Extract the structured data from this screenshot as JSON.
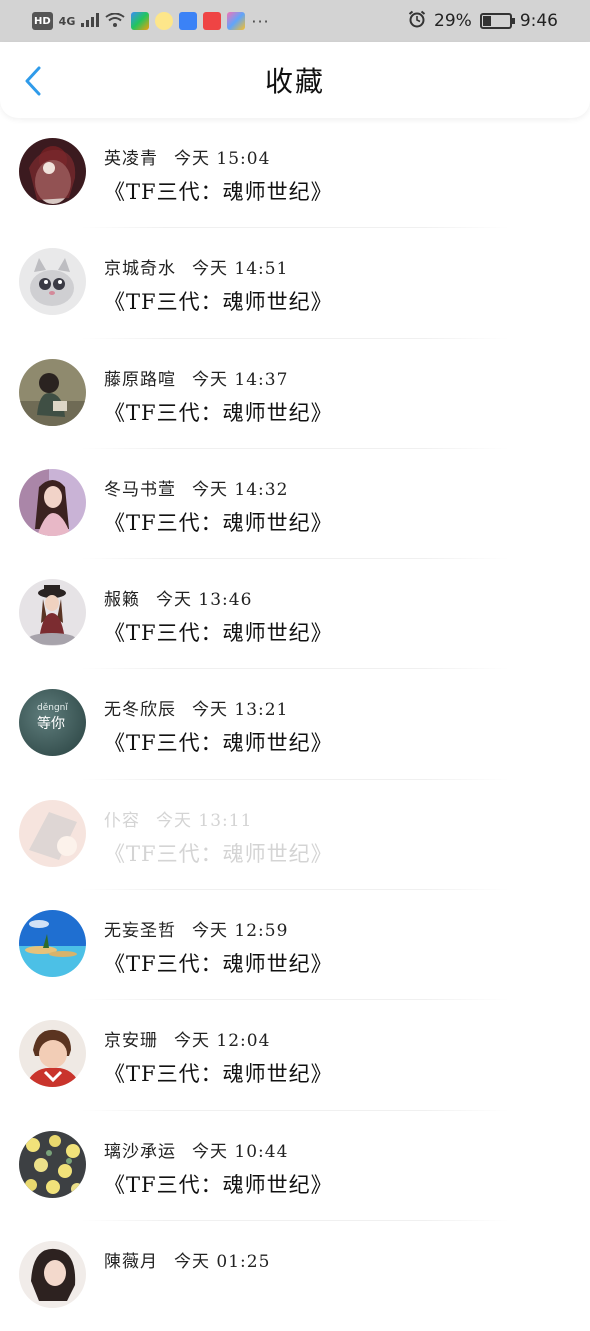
{
  "status_bar": {
    "hd": "HD",
    "network": "4G",
    "battery": "29%",
    "time": "9:46",
    "dots": "···"
  },
  "header": {
    "title": "收藏",
    "back_icon": "chevron-left-icon"
  },
  "items": [
    {
      "name": "英凌青",
      "time": "今天 15:04",
      "book": "《TF三代：魂师世纪》"
    },
    {
      "name": "京城奇水",
      "time": "今天 14:51",
      "book": "《TF三代：魂师世纪》"
    },
    {
      "name": "藤原路喧",
      "time": "今天 14:37",
      "book": "《TF三代：魂师世纪》"
    },
    {
      "name": "冬马书萱",
      "time": "今天 14:32",
      "book": "《TF三代：魂师世纪》"
    },
    {
      "name": "赧籁",
      "time": "今天 13:46",
      "book": "《TF三代：魂师世纪》"
    },
    {
      "name": "无冬欣辰",
      "time": "今天 13:21",
      "book": "《TF三代：魂师世纪》",
      "avatar_text_top": "děngnǐ",
      "avatar_text": "等你"
    },
    {
      "name": "仆容",
      "time": "今天 13:11",
      "book": "《TF三代：魂师世纪》"
    },
    {
      "name": "无妄圣哲",
      "time": "今天 12:59",
      "book": "《TF三代：魂师世纪》"
    },
    {
      "name": "京安珊",
      "time": "今天 12:04",
      "book": "《TF三代：魂师世纪》"
    },
    {
      "name": "璃沙承运",
      "time": "今天 10:44",
      "book": "《TF三代：魂师世纪》"
    },
    {
      "name": "陳薇月",
      "time": "今天 01:25",
      "book": ""
    }
  ],
  "colors": {
    "accent_blue": "#2f9bea",
    "status_bar_bg": "#d3d3d3"
  }
}
